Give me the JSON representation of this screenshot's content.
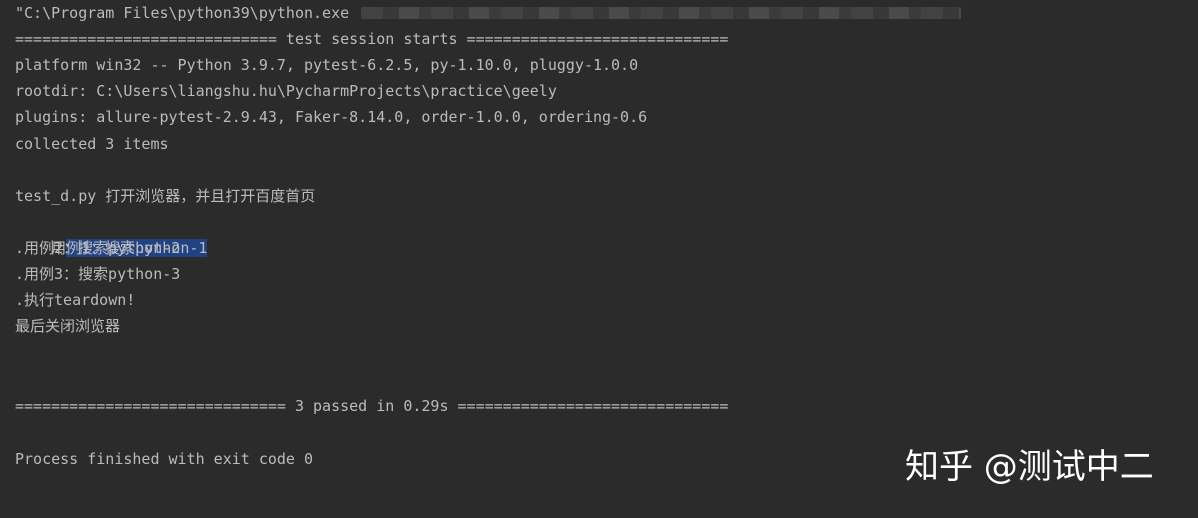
{
  "console": {
    "command": "\"C:\\Program Files\\python39\\python.exe",
    "session_start": "============================= test session starts =============================",
    "platform": "platform win32 -- Python 3.9.7, pytest-6.2.5, py-1.10.0, pluggy-1.0.0",
    "rootdir": "rootdir: C:\\Users\\liangshu.hu\\PycharmProjects\\practice\\geely",
    "plugins": "plugins: allure-pytest-2.9.43, Faker-8.14.0, order-1.0.0, ordering-0.6",
    "collected": "collected 3 items",
    "test_file": "test_d.py 打开浏览器，并且打开百度首页",
    "case1_prefix": "用",
    "case1_selected": "例1：搜索python-1",
    "case2": ".用例2：搜索python-2",
    "case3": ".用例3：搜索python-3",
    "teardown": ".执行teardown!",
    "close_browser": "最后关闭浏览器",
    "summary": "============================== 3 passed in 0.29s ==============================",
    "process_finished": "Process finished with exit code 0"
  },
  "watermark": "知乎 @测试中二",
  "colors": {
    "background": "#2b2b2b",
    "text": "#bbbbbb",
    "selection": "#214283"
  }
}
